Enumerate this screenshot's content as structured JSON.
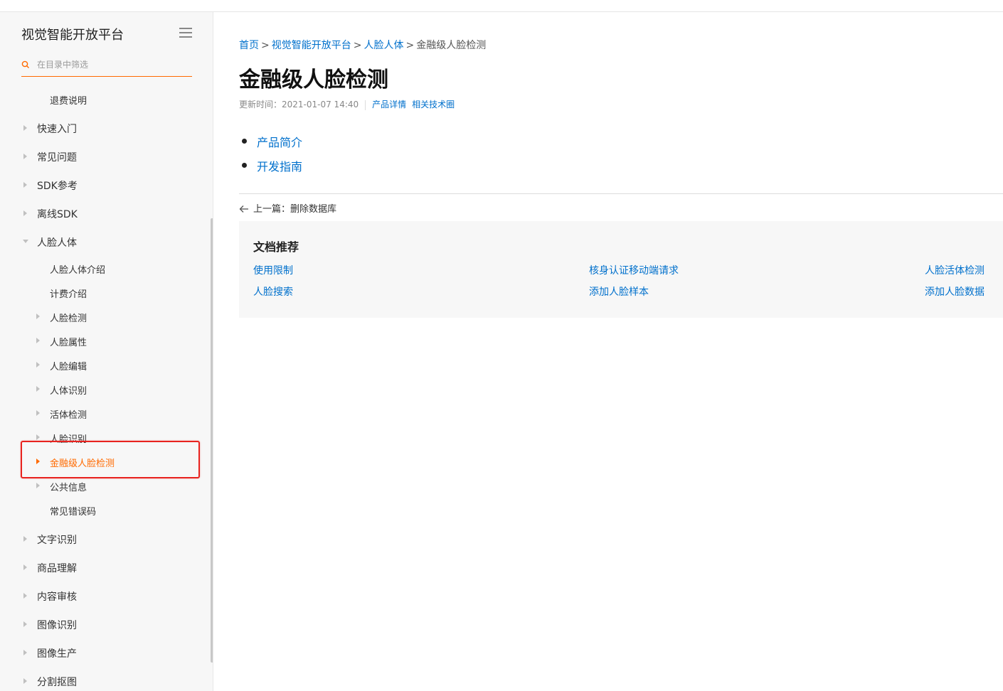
{
  "sidebar": {
    "title": "视觉智能开放平台",
    "filter_placeholder": "在目录中筛选",
    "items": [
      {
        "label": "退费说明"
      },
      {
        "label": "快速入门"
      },
      {
        "label": "常见问题"
      },
      {
        "label": "SDK参考"
      },
      {
        "label": "离线SDK"
      },
      {
        "label": "人脸人体"
      },
      {
        "label": "人脸人体介绍"
      },
      {
        "label": "计费介绍"
      },
      {
        "label": "人脸检测"
      },
      {
        "label": "人脸属性"
      },
      {
        "label": "人脸编辑"
      },
      {
        "label": "人体识别"
      },
      {
        "label": "活体检测"
      },
      {
        "label": "人脸识别"
      },
      {
        "label": "金融级人脸检测"
      },
      {
        "label": "公共信息"
      },
      {
        "label": "常见错误码"
      },
      {
        "label": "文字识别"
      },
      {
        "label": "商品理解"
      },
      {
        "label": "内容审核"
      },
      {
        "label": "图像识别"
      },
      {
        "label": "图像生产"
      },
      {
        "label": "分割抠图"
      }
    ]
  },
  "breadcrumb": {
    "home": "首页",
    "platform": "视觉智能开放平台",
    "category": "人脸人体",
    "current": "金融级人脸检测",
    "sep": ">"
  },
  "page": {
    "title": "金融级人脸检测",
    "updated": "更新时间：2021-01-07 14:40",
    "product_detail": "产品详情",
    "tech_circle": "相关技术圈"
  },
  "toc": [
    {
      "label": "产品简介"
    },
    {
      "label": "开发指南"
    }
  ],
  "prev": {
    "label": "上一篇：删除数据库"
  },
  "recommend": {
    "title": "文档推荐",
    "links": [
      {
        "label": "使用限制"
      },
      {
        "label": "核身认证移动端请求"
      },
      {
        "label": "人脸活体检测"
      },
      {
        "label": "人脸搜索"
      },
      {
        "label": "添加人脸样本"
      },
      {
        "label": "添加人脸数据"
      }
    ]
  },
  "colors": {
    "accent": "#ff6a00",
    "link": "#0070cc",
    "highlight_border": "#e8231f"
  }
}
